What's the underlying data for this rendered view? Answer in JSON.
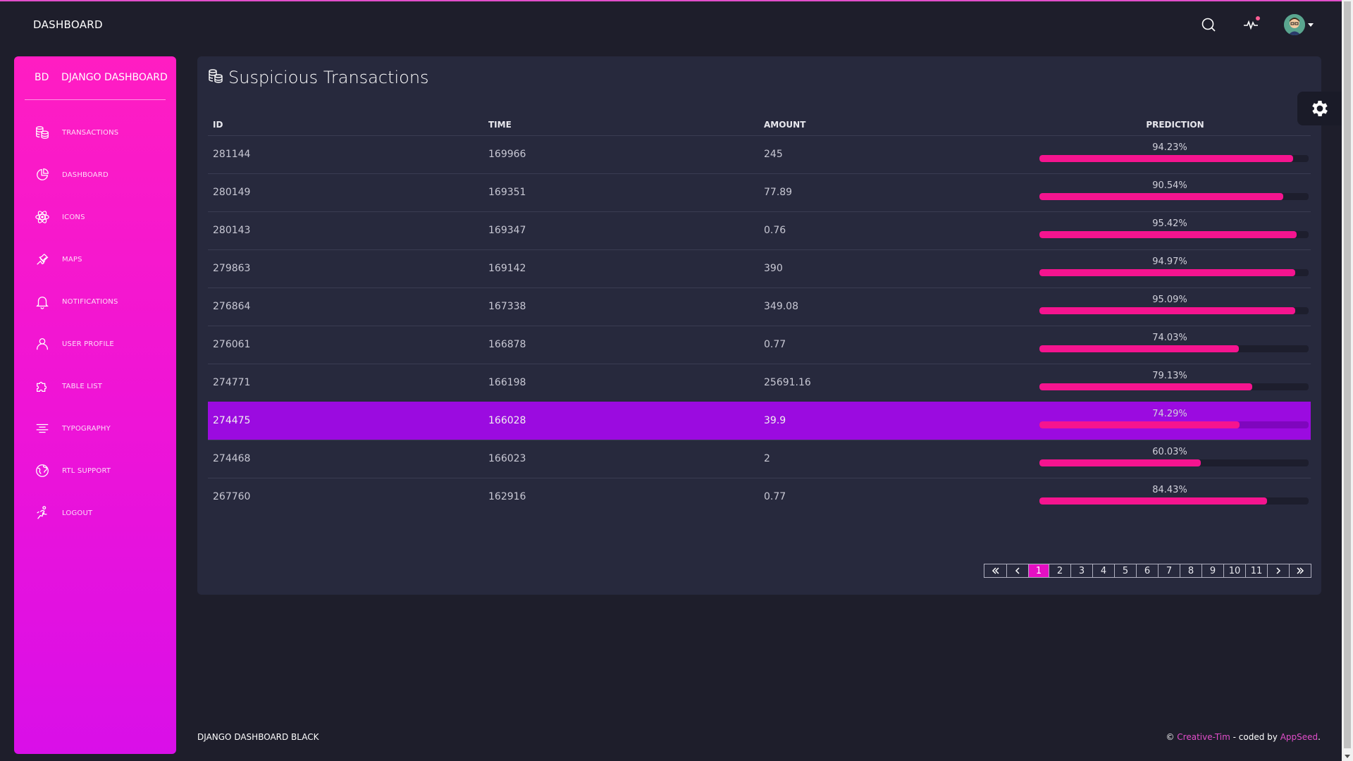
{
  "navbar": {
    "brand": "DASHBOARD"
  },
  "sidebar": {
    "logo_mini": "BD",
    "logo_text": "DJANGO DASHBOARD",
    "items": [
      {
        "label": "TRANSACTIONS",
        "icon": "coins-icon"
      },
      {
        "label": "DASHBOARD",
        "icon": "chart-pie-icon"
      },
      {
        "label": "ICONS",
        "icon": "atom-icon"
      },
      {
        "label": "MAPS",
        "icon": "pin-icon"
      },
      {
        "label": "NOTIFICATIONS",
        "icon": "bell-icon"
      },
      {
        "label": "USER PROFILE",
        "icon": "user-icon"
      },
      {
        "label": "TABLE LIST",
        "icon": "puzzle-icon"
      },
      {
        "label": "TYPOGRAPHY",
        "icon": "align-center-icon"
      },
      {
        "label": "RTL SUPPORT",
        "icon": "world-icon"
      },
      {
        "label": "LOGOUT",
        "icon": "user-run-icon"
      }
    ]
  },
  "card": {
    "title": "Suspicious Transactions",
    "columns": [
      "ID",
      "TIME",
      "AMOUNT",
      "PREDICTION"
    ],
    "rows": [
      {
        "id": "281144",
        "time": "169966",
        "amount": "245",
        "prediction": "94.23%",
        "value": 94.23
      },
      {
        "id": "280149",
        "time": "169351",
        "amount": "77.89",
        "prediction": "90.54%",
        "value": 90.54
      },
      {
        "id": "280143",
        "time": "169347",
        "amount": "0.76",
        "prediction": "95.42%",
        "value": 95.42
      },
      {
        "id": "279863",
        "time": "169142",
        "amount": "390",
        "prediction": "94.97%",
        "value": 94.97
      },
      {
        "id": "276864",
        "time": "167338",
        "amount": "349.08",
        "prediction": "95.09%",
        "value": 95.09
      },
      {
        "id": "276061",
        "time": "166878",
        "amount": "0.77",
        "prediction": "74.03%",
        "value": 74.03
      },
      {
        "id": "274771",
        "time": "166198",
        "amount": "25691.16",
        "prediction": "79.13%",
        "value": 79.13
      },
      {
        "id": "274475",
        "time": "166028",
        "amount": "39.9",
        "prediction": "74.29%",
        "value": 74.29,
        "highlighted": true
      },
      {
        "id": "274468",
        "time": "166023",
        "amount": "2",
        "prediction": "60.03%",
        "value": 60.03
      },
      {
        "id": "267760",
        "time": "162916",
        "amount": "0.77",
        "prediction": "84.43%",
        "value": 84.43
      }
    ]
  },
  "pagination": {
    "pages": [
      "1",
      "2",
      "3",
      "4",
      "5",
      "6",
      "7",
      "8",
      "9",
      "10",
      "11"
    ],
    "active": "1"
  },
  "footer": {
    "left": "DJANGO DASHBOARD BLACK",
    "copyright": "©",
    "creative_tim": "Creative-Tim",
    "coded_by": "- coded by",
    "appseed": "AppSeed",
    "period": "."
  },
  "colors": {
    "accent": "#e14eca",
    "sidebar_top": "#ff1dc2",
    "sidebar_bottom": "#d90fe8",
    "bar": "#f5148f",
    "highlight_row": "#9b0be0",
    "card_bg": "#27293d",
    "page_bg": "#1e1e2b"
  }
}
